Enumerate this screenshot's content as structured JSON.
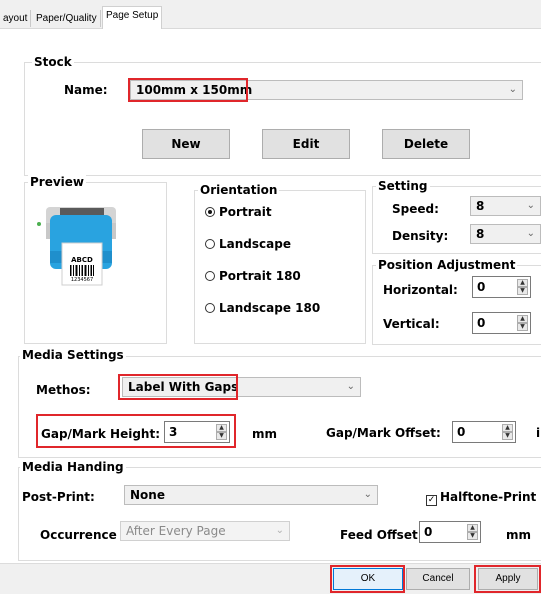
{
  "tabs": [
    "ayout",
    "Paper/Quality",
    "Page Setup"
  ],
  "stock": {
    "group_label": "Stock",
    "name_label": "Name:",
    "name_value": "100mm x 150mm",
    "buttons": {
      "new": "New",
      "edit": "Edit",
      "delete": "Delete"
    }
  },
  "preview": {
    "group_label": "Preview",
    "label_text": "ABCD",
    "label_number": "1234567"
  },
  "orientation": {
    "group_label": "Orientation",
    "options": [
      "Portrait",
      "Landscape",
      "Portrait 180",
      "Landscape 180"
    ],
    "selected": "Portrait"
  },
  "setting": {
    "group_label": "Setting",
    "speed_label": "Speed:",
    "speed_value": "8",
    "density_label": "Density:",
    "density_value": "8"
  },
  "position": {
    "group_label": "Position Adjustment",
    "horizontal_label": "Horizontal:",
    "horizontal_value": "0",
    "vertical_label": "Vertical:",
    "vertical_value": "0"
  },
  "media_settings": {
    "group_label": "Media Settings",
    "methos_label": "Methos:",
    "methos_value": "Label With Gaps",
    "gap_label": "Gap/Mark Height:",
    "gap_value": "3",
    "gap_unit": "mm",
    "offset_label": "Gap/Mark Offset:",
    "offset_value": "0",
    "offset_unit": "i"
  },
  "media_handing": {
    "group_label": "Media Handing",
    "post_print_label": "Post-Print:",
    "post_print_value": "None",
    "halftone_label": "Halftone-Print",
    "halftone_checked": true,
    "occurrence_label": "Occurrence",
    "occurrence_value": "After Every Page",
    "feed_offset_label": "Feed Offset:",
    "feed_offset_value": "0",
    "feed_offset_unit": "mm"
  },
  "footer": {
    "ok": "OK",
    "cancel": "Cancel",
    "apply": "Apply"
  },
  "colors": {
    "highlight": "#e0262b",
    "printer_accent": "#29a3e0",
    "led": "#4caf50"
  }
}
